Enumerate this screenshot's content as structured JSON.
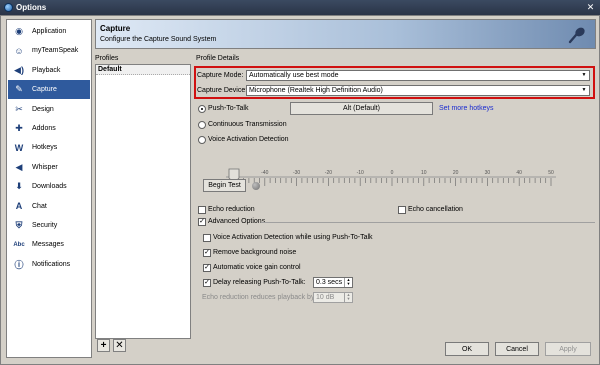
{
  "window": {
    "title": "Options",
    "close_label": "✕"
  },
  "nav": {
    "items": [
      {
        "label": "Application",
        "icon": "app-icon",
        "glyph": "◉"
      },
      {
        "label": "myTeamSpeak",
        "icon": "user-icon",
        "glyph": "☺"
      },
      {
        "label": "Playback",
        "icon": "speaker-icon",
        "glyph": "◀)"
      },
      {
        "label": "Capture",
        "icon": "microphone-icon",
        "glyph": "✎",
        "selected": true
      },
      {
        "label": "Design",
        "icon": "design-icon",
        "glyph": "✂"
      },
      {
        "label": "Addons",
        "icon": "puzzle-icon",
        "glyph": "✚"
      },
      {
        "label": "Hotkeys",
        "icon": "keyboard-icon",
        "glyph": "W"
      },
      {
        "label": "Whisper",
        "icon": "whisper-icon",
        "glyph": "◀"
      },
      {
        "label": "Downloads",
        "icon": "download-icon",
        "glyph": "⬇"
      },
      {
        "label": "Chat",
        "icon": "chat-icon",
        "glyph": "A"
      },
      {
        "label": "Security",
        "icon": "shield-icon",
        "glyph": "⛨"
      },
      {
        "label": "Messages",
        "icon": "messages-icon",
        "glyph": "Abc"
      },
      {
        "label": "Notifications",
        "icon": "notification-icon",
        "glyph": "ⓘ"
      }
    ]
  },
  "header": {
    "title": "Capture",
    "subtitle": "Configure the Capture Sound System"
  },
  "profiles": {
    "label": "Profiles",
    "items": [
      "Default"
    ],
    "add_label": "+",
    "remove_label": "✕"
  },
  "details": {
    "label": "Profile Details",
    "capture_mode": {
      "label": "Capture Mode:",
      "value": "Automatically use best mode"
    },
    "capture_device": {
      "label": "Capture Device:",
      "value": "Microphone (Realtek High Definition Audio)"
    },
    "ptt": {
      "label": "Push-To-Talk",
      "checked": true,
      "hotkey": "Alt (Default)",
      "more_hotkeys": "Set more hotkeys"
    },
    "continuous": {
      "label": "Continuous Transmission",
      "checked": false
    },
    "vad": {
      "label": "Voice Activation Detection",
      "checked": false
    },
    "slider": {
      "ticks": [
        "-50",
        "-40",
        "-30",
        "-20",
        "-10",
        "0",
        "10",
        "20",
        "30",
        "40",
        "50"
      ]
    },
    "begin_test": "Begin Test",
    "echo_reduction": {
      "label": "Echo reduction",
      "checked": false
    },
    "echo_cancellation": {
      "label": "Echo cancellation",
      "checked": false
    },
    "advanced": {
      "label": "Advanced Options",
      "checked": true
    },
    "vad_while_ptt": {
      "label": "Voice Activation Detection while using Push-To-Talk",
      "checked": false
    },
    "remove_noise": {
      "label": "Remove background noise",
      "checked": true
    },
    "agc": {
      "label": "Automatic voice gain control",
      "checked": true
    },
    "delay_release": {
      "label": "Delay releasing Push-To-Talk:",
      "checked": true,
      "value": "0.3 secs"
    },
    "echo_playback": {
      "label": "Echo reduction reduces playback by:",
      "value": "10 dB"
    }
  },
  "buttons": {
    "ok": "OK",
    "cancel": "Cancel",
    "apply": "Apply"
  }
}
